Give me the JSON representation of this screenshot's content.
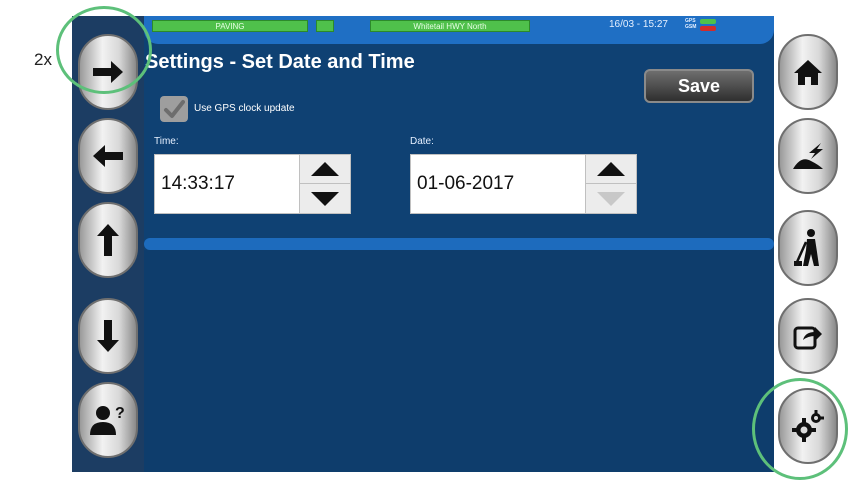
{
  "annotation": {
    "zoom_label": "2x"
  },
  "status_bar": {
    "mode": "PAVING",
    "road_name": "Whitetail HWY North",
    "clock": "16/03 - 15:27",
    "gps_label": "GPS",
    "gsm_label": "GSM",
    "gps_status_color": "#4fc04b",
    "gsm_status_color": "#d22b2b"
  },
  "page": {
    "title": "Settings  -  Set Date and Time"
  },
  "toolbar": {
    "save_label": "Save"
  },
  "gps_clock": {
    "label": "Use GPS clock update",
    "checked": true
  },
  "time": {
    "label": "Time:",
    "value": "14:33:17"
  },
  "date": {
    "label": "Date:",
    "value": "01-06-2017"
  },
  "left_nav": [
    {
      "icon": "arrow-right-icon"
    },
    {
      "icon": "arrow-left-icon"
    },
    {
      "icon": "arrow-up-icon"
    },
    {
      "icon": "arrow-down-icon"
    },
    {
      "icon": "user-help-icon"
    }
  ],
  "right_nav": [
    {
      "icon": "home-icon"
    },
    {
      "icon": "paving-job-icon"
    },
    {
      "icon": "worker-icon"
    },
    {
      "icon": "export-icon"
    },
    {
      "icon": "settings-gears-icon"
    }
  ],
  "colors": {
    "screen_bg": "#0f4173",
    "accent": "#1f6fc4",
    "highlight_ring": "#5dc07a"
  }
}
